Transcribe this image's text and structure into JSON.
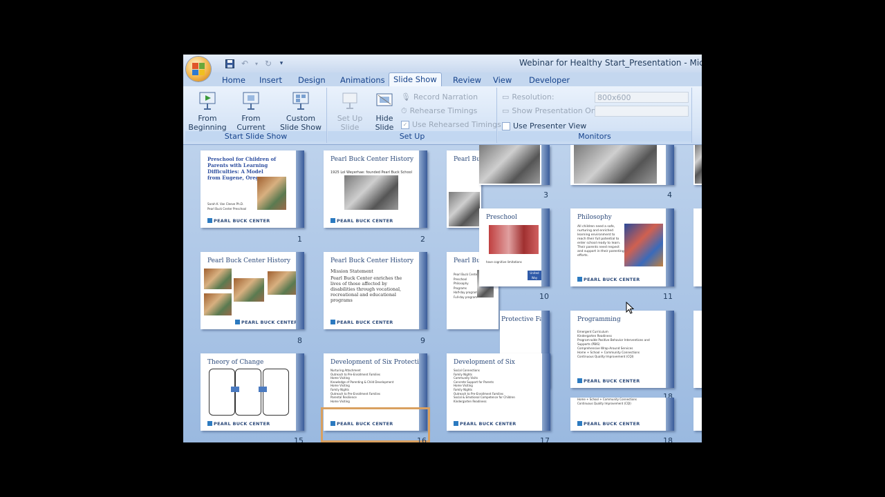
{
  "window": {
    "title": "Webinar for Healthy Start_Presentation - Microsoft Po"
  },
  "quick_access": {
    "save_icon": "save-icon",
    "undo_icon": "undo-icon",
    "redo_icon": "redo-icon",
    "customize_icon": "customize-qat-icon"
  },
  "tabs": [
    "Home",
    "Insert",
    "Design",
    "Animations",
    "Slide Show",
    "Review",
    "View",
    "Developer"
  ],
  "active_tab": "Slide Show",
  "ribbon": {
    "start_group": {
      "label": "Start Slide Show",
      "from_beginning": "From Beginning",
      "from_current": "From Current Slide",
      "custom": "Custom Slide Show"
    },
    "setup_group": {
      "label": "Set Up",
      "setup_show": "Set Up Slide Show",
      "hide_slide": "Hide Slide",
      "record_narration": "Record Narration",
      "rehearse_timings": "Rehearse Timings",
      "use_rehearsed": "Use Rehearsed Timings"
    },
    "monitors_group": {
      "label": "Monitors",
      "resolution_label": "Resolution:",
      "resolution_value": "800x600",
      "show_on_label": "Show Presentation On:",
      "presenter_view": "Use Presenter View"
    }
  },
  "slides": {
    "s1": {
      "title": "Preschool for Children of Parents with Learning Difficulties: A Model from Eugene, Oregon",
      "num": "1",
      "author": "Sarah K. Van Cleeve Ph.D.",
      "org": "Pearl Buck Center Preschool"
    },
    "s2": {
      "title": "Pearl Buck Center History",
      "num": "2",
      "bullet": "1925 Lol Weyerhae: founded Pearl Buck School"
    },
    "s3": {
      "title": "Pearl Bu"
    },
    "s8": {
      "title": "Pearl Buck Center History",
      "num": "8"
    },
    "s9": {
      "title": "Pearl Buck Center History",
      "num": "9",
      "subtitle": "Mission Statement",
      "text": "Pearl Buck Center enriches the lives of those affected by disabilities through vocational, recreational and educational programs"
    },
    "s10": {
      "title": "Preschool",
      "num": "10",
      "badge": "United Way"
    },
    "s11": {
      "title": "Philosophy",
      "num": "11",
      "text": "All children need a safe, nurturing and enriched learning environment to reach their full potential to enter school ready to learn. Their parents need respect and support in their parenting efforts."
    },
    "s12": {
      "title": "Pearl Buck"
    },
    "s15": {
      "title": "Theory of Change",
      "num": "15"
    },
    "s16": {
      "title": "Development of Six Protective Factor",
      "num": "16",
      "items": [
        "Nurturing Attachment",
        "Outreach to Pre-Enrollment Families",
        "Home Visiting",
        "Knowledge of Parenting & Child Development",
        "Home Visiting",
        "Family Nights",
        "Outreach to Pre-Enrollment Families",
        "Parental Resilience",
        "Home Visiting"
      ]
    },
    "s17": {
      "title": "Development of Six",
      "num": "17",
      "items": [
        "Social Connections",
        "Family Nights",
        "Community Visits",
        "Concrete Support for Parents",
        "Home Visiting",
        "Family Nights",
        "Outreach to Pre-Enrollment Families",
        "Social & Emotional Competence for Children",
        "Kindergarten Readiness"
      ]
    },
    "s17b": {
      "title": "Protective Factor",
      "num": "17"
    },
    "s18": {
      "title": "Programming",
      "num": "18",
      "items": [
        "Emergent Curriculum",
        "Kindergarten Readiness",
        "Program-wide Positive Behavior Interventions and Supports (PBIS)",
        "Comprehensive Wrap-Around Services",
        "Home + School + Community Connections",
        "Continuous Quality Improvement (CQI)"
      ]
    },
    "s18b": {
      "num": "18",
      "items": [
        "Home + School + Community Connections",
        "Continuous Quality Improvement (CQI)"
      ]
    },
    "s3b": {
      "num": "3"
    },
    "s4b": {
      "num": "4"
    }
  },
  "logo_text": "PEARL BUCK CENTER",
  "colors": {
    "ribbon_blue": "#15428b",
    "sorter_bg": "#9ab9e0",
    "slide_bar": "#3a5c9a",
    "selection": "#d9a060"
  }
}
